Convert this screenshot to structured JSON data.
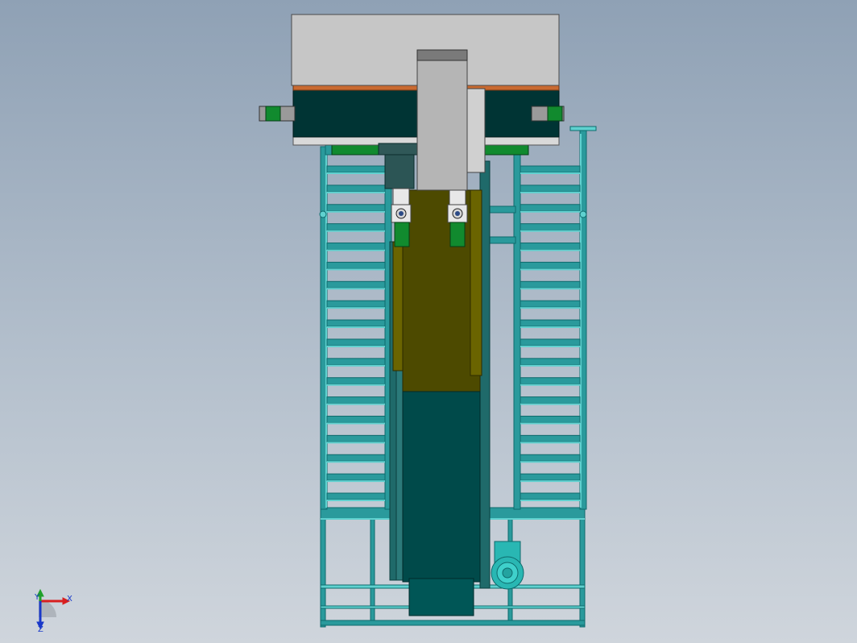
{
  "viewport": {
    "background_top": "#8fa1b5",
    "background_bottom": "#cfd5dc"
  },
  "model": {
    "colors": {
      "frame_teal": "#2a9a9c",
      "frame_dark": "#0e6a6c",
      "rail_light": "#5fd1cf",
      "column_olive": "#4d4a00",
      "column_dark_teal": "#004a4a",
      "head_gray": "#c6c6c6",
      "head_dark": "#003434",
      "head_orange": "#c96a30",
      "slider_gray": "#b5b5b5",
      "green_pad": "#118a2e",
      "motor_teal": "#29b7b3"
    },
    "ladder_rungs_per_side": 18
  },
  "triad": {
    "x_label": "X",
    "y_label": "Y",
    "z_label": "Z",
    "x_color": "#d81f1f",
    "y_color": "#1fa02a",
    "z_color": "#1a39c9"
  }
}
